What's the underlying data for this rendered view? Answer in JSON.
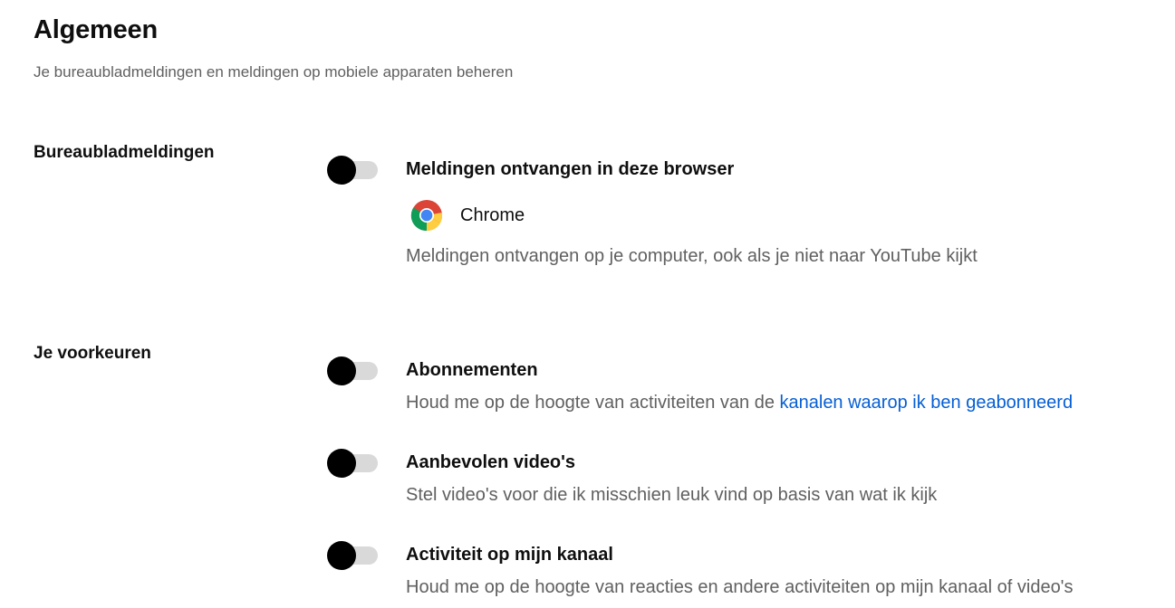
{
  "header": {
    "title": "Algemeen",
    "subtitle": "Je bureaubladmeldingen en meldingen op mobiele apparaten beheren"
  },
  "desktop": {
    "section_label": "Bureaubladmeldingen",
    "toggle": {
      "title": "Meldingen ontvangen in deze browser",
      "browser_name": "Chrome",
      "browser_icon": "chrome-icon",
      "description": "Meldingen ontvangen op je computer, ook als je niet naar YouTube kijkt",
      "enabled": false
    }
  },
  "preferences": {
    "section_label": "Je voorkeuren",
    "items": [
      {
        "title": "Abonnementen",
        "description": "Houd me op de hoogte van activiteiten van de ",
        "link_text": "kanalen waarop ik ben geabonneerd",
        "enabled": false
      },
      {
        "title": "Aanbevolen video's",
        "description": "Stel video's voor die ik misschien leuk vind op basis van wat ik kijk",
        "enabled": false
      },
      {
        "title": "Activiteit op mijn kanaal",
        "description": "Houd me op de hoogte van reacties en andere activiteiten op mijn kanaal of video's",
        "enabled": false
      }
    ]
  },
  "colors": {
    "text_primary": "#0f0f0f",
    "text_secondary": "#606060",
    "link": "#065fd4",
    "toggle_track": "#d9d9d9",
    "toggle_knob": "#000000"
  }
}
